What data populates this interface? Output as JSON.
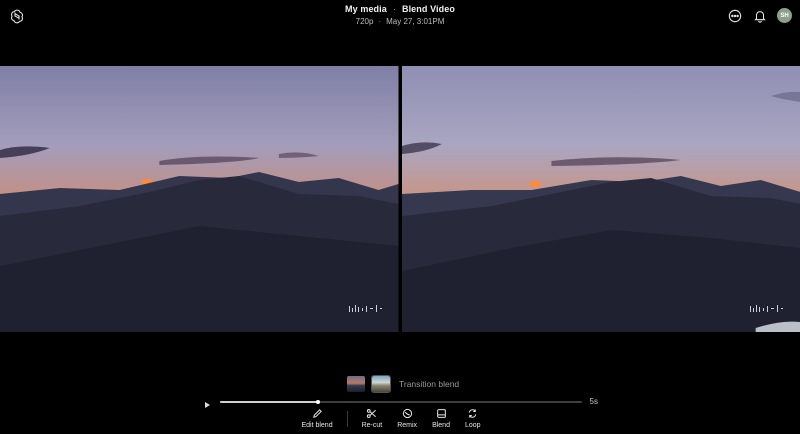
{
  "header": {
    "breadcrumb_root": "My media",
    "separator": "·",
    "page_title": "Blend Video",
    "resolution": "720p",
    "timestamp": "May 27, 3:01PM",
    "avatar_initials": "SH"
  },
  "icons": {
    "logo": "openai-logo-icon",
    "more": "more-options-icon",
    "notifications": "bell-icon",
    "play": "play-icon"
  },
  "videos": [
    {
      "label": "source-video-left",
      "watermark": "sora-watermark-icon"
    },
    {
      "label": "source-video-right",
      "watermark": "sora-watermark-icon"
    }
  ],
  "transition": {
    "label": "Transition blend"
  },
  "playback": {
    "duration": "5s",
    "progress": 0.27
  },
  "toolbar": {
    "edit_blend": "Edit blend",
    "recut": "Re-cut",
    "remix": "Remix",
    "blend": "Blend",
    "loop": "Loop"
  },
  "colors": {
    "background": "#000000",
    "sky_top": "#a9a6c3",
    "sunset": "#e58a4a",
    "mountain": "#2a2c3d"
  }
}
